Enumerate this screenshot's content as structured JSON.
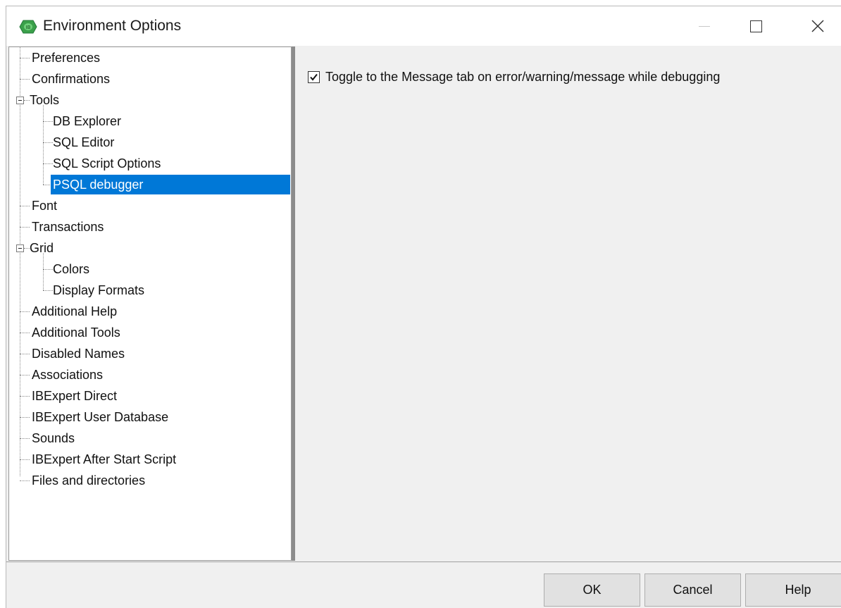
{
  "window": {
    "title": "Environment Options",
    "app_icon": "ibexpert-logo-icon",
    "controls": [
      "minimize-icon",
      "maximize-icon",
      "close-icon"
    ]
  },
  "tree": {
    "items": [
      {
        "label": "Preferences",
        "level": 0
      },
      {
        "label": "Confirmations",
        "level": 0
      },
      {
        "label": "Tools",
        "level": 0,
        "expanded": true
      },
      {
        "label": "DB Explorer",
        "level": 1
      },
      {
        "label": "SQL Editor",
        "level": 1
      },
      {
        "label": "SQL Script Options",
        "level": 1
      },
      {
        "label": "PSQL debugger",
        "level": 1,
        "selected": true
      },
      {
        "label": "Font",
        "level": 0
      },
      {
        "label": "Transactions",
        "level": 0
      },
      {
        "label": "Grid",
        "level": 0,
        "expanded": true
      },
      {
        "label": "Colors",
        "level": 1
      },
      {
        "label": "Display Formats",
        "level": 1
      },
      {
        "label": "Additional Help",
        "level": 0
      },
      {
        "label": "Additional Tools",
        "level": 0
      },
      {
        "label": "Disabled Names",
        "level": 0
      },
      {
        "label": "Associations",
        "level": 0
      },
      {
        "label": "IBExpert Direct",
        "level": 0
      },
      {
        "label": "IBExpert User Database",
        "level": 0
      },
      {
        "label": "Sounds",
        "level": 0
      },
      {
        "label": "IBExpert After Start Script",
        "level": 0
      },
      {
        "label": "Files and directories",
        "level": 0
      }
    ]
  },
  "content": {
    "toggle_message_tab": {
      "label": "Toggle to the Message tab on error/warning/message while debugging",
      "checked": true
    }
  },
  "buttons": {
    "ok": "OK",
    "cancel": "Cancel",
    "help": "Help"
  },
  "colors": {
    "selection": "#0078d7",
    "dialog_bg": "#f0f0f0"
  }
}
